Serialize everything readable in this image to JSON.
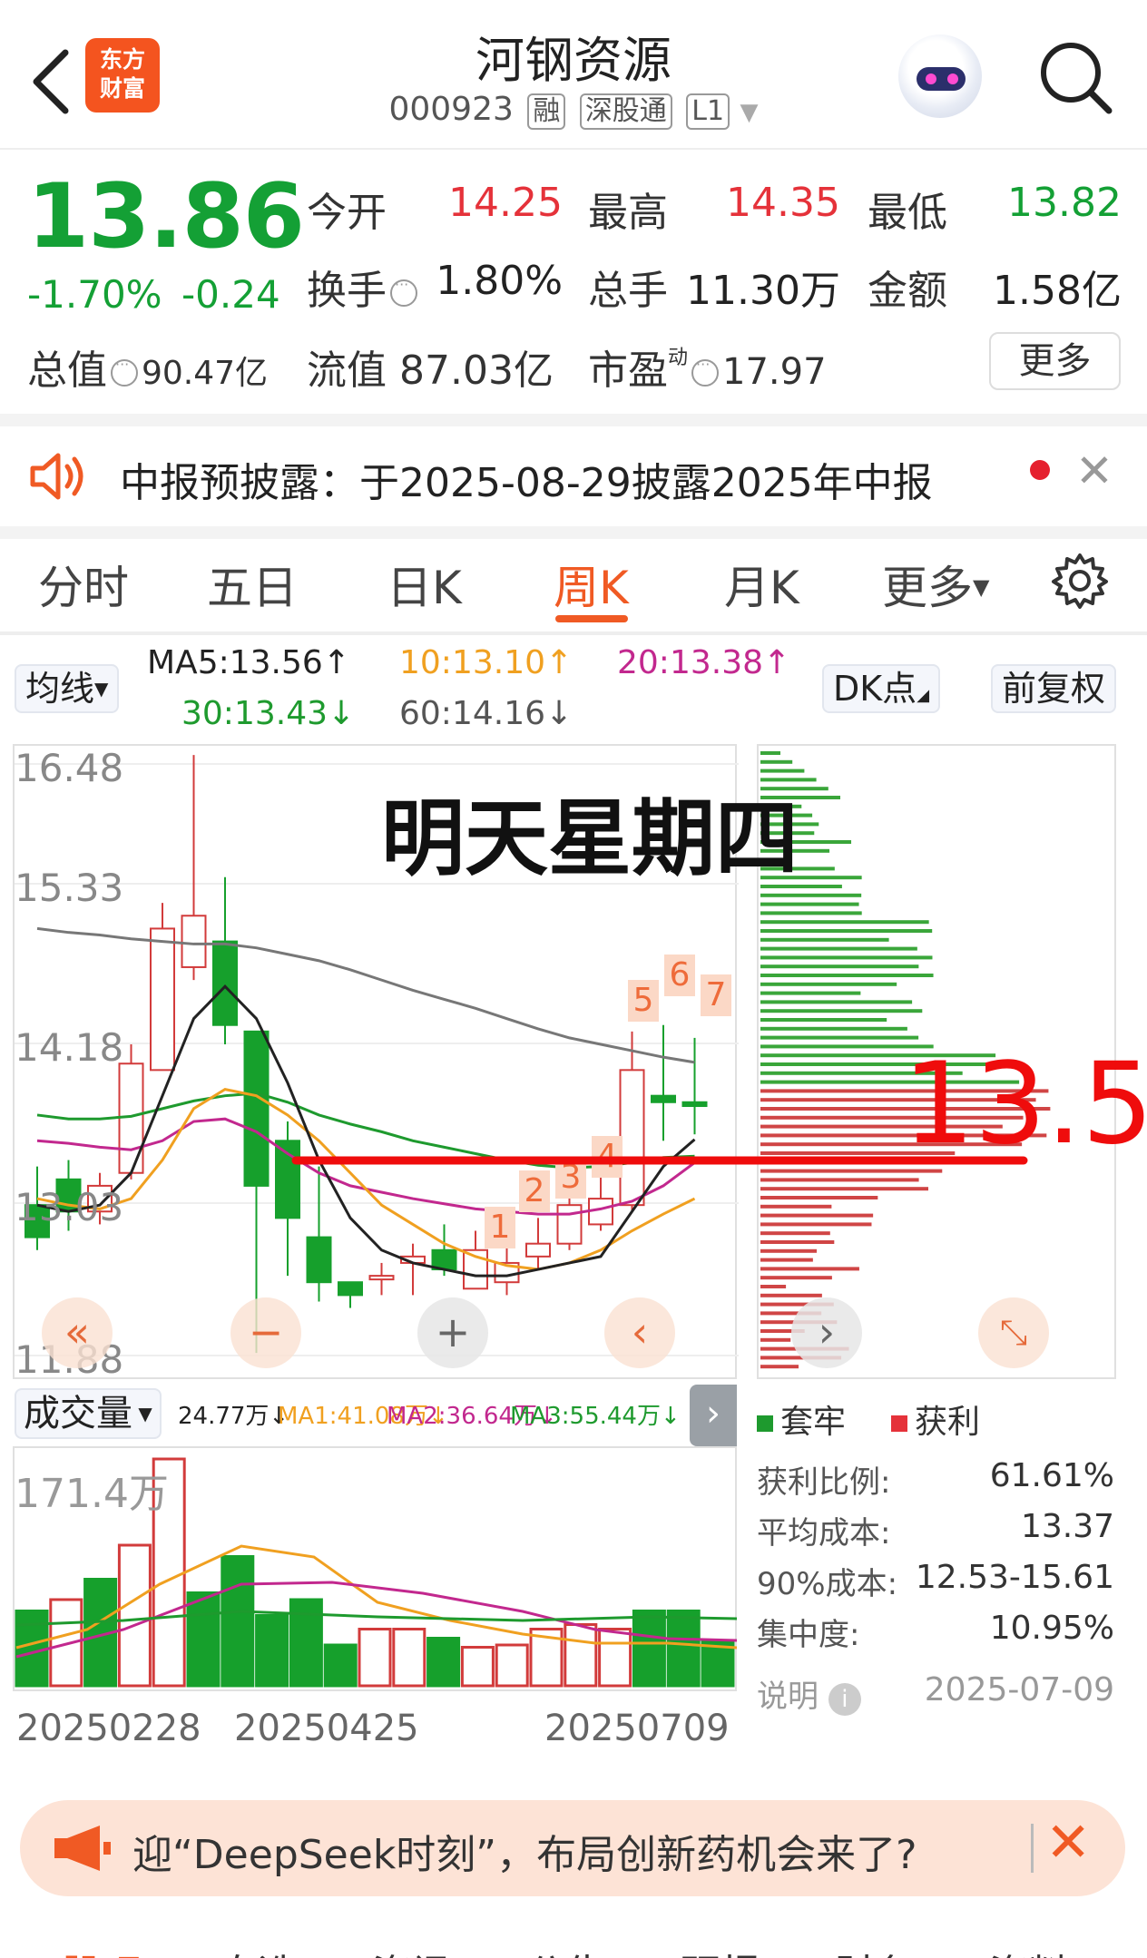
{
  "header": {
    "logo_line1": "东方",
    "logo_line2": "财富",
    "title": "河钢资源",
    "code": "000923",
    "tags": [
      "融",
      "深股通",
      "L1"
    ]
  },
  "quote": {
    "price": "13.86",
    "change_pct": "-1.70%",
    "change": "-0.24",
    "open_label": "今开",
    "open": "14.25",
    "high_label": "最高",
    "high": "14.35",
    "low_label": "最低",
    "low": "13.82",
    "turnover_label": "换手",
    "turnover": "1.80%",
    "volume_label": "总手",
    "volume": "11.30万",
    "amount_label": "金额",
    "amount": "1.58亿",
    "mktcap_label": "总值",
    "mktcap": "90.47亿",
    "float_label": "流值",
    "float_cap": "87.03亿",
    "pe_label": "市盈",
    "pe_sup": "动",
    "pe": "17.97",
    "more": "更多"
  },
  "notice": {
    "text": "中报预披露：于2025-08-29披露2025年中报"
  },
  "tabs": [
    "分时",
    "五日",
    "日K",
    "周K",
    "月K",
    "更多"
  ],
  "active_tab": "周K",
  "ma_row": {
    "select": "均线",
    "ma5": "MA5:13.56↑",
    "ma10": "10:13.10↑",
    "ma20": "20:13.38↑",
    "ma30": "30:13.43↓",
    "ma60": "60:14.16↓",
    "dk": "DK点",
    "adj": "前复权"
  },
  "chart": {
    "y_labels": [
      "16.48",
      "15.33",
      "14.18",
      "13.03",
      "11.88"
    ],
    "overlay_text": "明天星期四",
    "big_price": "13.5",
    "marks": [
      "1",
      "2",
      "3",
      "4",
      "5",
      "6",
      "7"
    ],
    "colors": {
      "up": "#d23b3b",
      "down": "#16a02c",
      "ma5": "#222222",
      "ma10": "#f0a020",
      "ma20": "#c2288e",
      "ma30": "#1e9a2e",
      "ma60": "#777777",
      "line": "#ef0c0c"
    }
  },
  "volume": {
    "label": "成交量",
    "cur": "24.77万↓",
    "ma1": "MA1:41.08万↓",
    "ma2": "MA2:36.64万↓",
    "ma3": "MA3:55.44万↓",
    "max_label": "171.4万"
  },
  "dates": [
    "20250228",
    "20250425",
    "20250709"
  ],
  "chip_stats": {
    "legend_trapped": "套牢",
    "legend_profit": "获利",
    "rows": [
      {
        "label": "获利比例:",
        "value": "61.61%"
      },
      {
        "label": "平均成本:",
        "value": "13.37"
      },
      {
        "label": "90%成本:",
        "value": "12.53-15.61"
      },
      {
        "label": "集中度:",
        "value": "10.95%"
      },
      {
        "label": "说明",
        "value": "2025-07-09"
      }
    ]
  },
  "banner": {
    "text": "迎“DeepSeek时刻”，布局创新药机会来了?"
  },
  "bottom_nav": [
    "股吧",
    "自选",
    "资讯",
    "公告",
    "研报",
    "财务",
    "资料"
  ]
}
